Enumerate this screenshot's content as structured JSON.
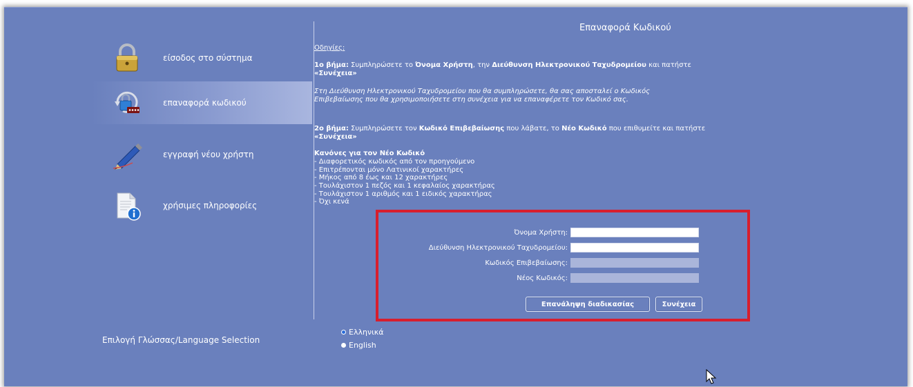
{
  "sidebar": {
    "items": [
      {
        "label": "είσοδος στο σύστημα",
        "icon": "padlock-icon",
        "active": false
      },
      {
        "label": "επαναφορά κωδικού",
        "icon": "reset-password-icon",
        "active": true
      },
      {
        "label": "εγγραφή νέου χρήστη",
        "icon": "pen-icon",
        "active": false
      },
      {
        "label": "χρήσιμες πληροφορίες",
        "icon": "info-document-icon",
        "active": false
      }
    ]
  },
  "main": {
    "title": "Επαναφορά Κωδικού",
    "instructions_label": "Οδηγίες:",
    "step1": {
      "prefix": "1ο βήμα:",
      "t1": " Συμπληρώσετε το ",
      "b1": "Όνομα Χρήστη",
      "t2": ", την ",
      "b2": "Διεύθυνση Ηλεκτρονικού Ταχυδρομείου",
      "t3": " και πατήστε ",
      "b3": "«Συνέχεια»"
    },
    "step1_note": "Στη Διεύθυνση Ηλεκτρονικού Ταχυδρομείου που θα συμπληρώσετε, θα σας αποσταλεί ο Κωδικός Επιβεβαίωσης που θα χρησιμοποιήσετε στη συνέχεια για να επαναφέρετε τον Κωδικό σας.",
    "step2": {
      "prefix": "2ο βήμα:",
      "t1": " Συμπληρώσετε τον ",
      "b1": "Κωδικό Επιβεβαίωσης",
      "t2": " που λάβατε, το ",
      "b2": "Νέο Κωδικό",
      "t3": " που επιθυμείτε και πατήστε ",
      "b3": "«Συνέχεια»"
    },
    "rules_title": "Κανόνες για τον Νέο Κωδικό",
    "rules": [
      "- Διαφορετικός κωδικός από τον προηγούμενο",
      "- Επιτρέπονται μόνο Λατινικοί χαρακτήρες",
      "- Μήκος από 8 έως και 12 χαρακτήρες",
      "- Τουλάχιστον 1 πεζός και 1 κεφαλαίος χαρακτήρας",
      "- Τουλάχιστον 1 αριθμός και 1 ειδικός χαρακτήρας",
      "- Όχι κενά"
    ]
  },
  "form": {
    "username_label": "Όνομα Χρήστη:",
    "username_value": "",
    "email_label": "Διεύθυνση Ηλεκτρονικού Ταχυδρομείου:",
    "email_value": "",
    "confirm_code_label": "Κωδικός Επιβεβαίωσης:",
    "new_password_label": "Νέος Κωδικός:",
    "repeat_button": "Επανάληψη διαδικασίας",
    "continue_button": "Συνέχεια"
  },
  "language": {
    "label": "Επιλογή Γλώσσας/Language Selection",
    "options": [
      {
        "label": "Ελληνικά",
        "selected": true
      },
      {
        "label": "English",
        "selected": false
      }
    ]
  },
  "colors": {
    "background": "#6a80bd",
    "highlight_border": "#d71e2d"
  }
}
